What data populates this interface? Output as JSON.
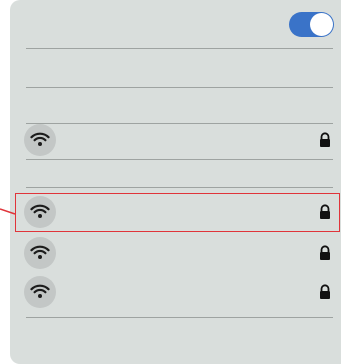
{
  "wifi_panel": {
    "toggle_state": "on",
    "accent_color": "#3a73c8",
    "networks": [
      {
        "name": "",
        "secured": true,
        "icon": "wifi-icon",
        "lock": "lock-icon"
      },
      {
        "name": "",
        "secured": true,
        "icon": "wifi-icon",
        "lock": "lock-icon",
        "highlighted": true
      },
      {
        "name": "",
        "secured": true,
        "icon": "wifi-icon",
        "lock": "lock-icon"
      },
      {
        "name": "",
        "secured": true,
        "icon": "wifi-icon",
        "lock": "lock-icon"
      }
    ]
  },
  "annotation": {
    "highlight_color": "#e0343a"
  }
}
